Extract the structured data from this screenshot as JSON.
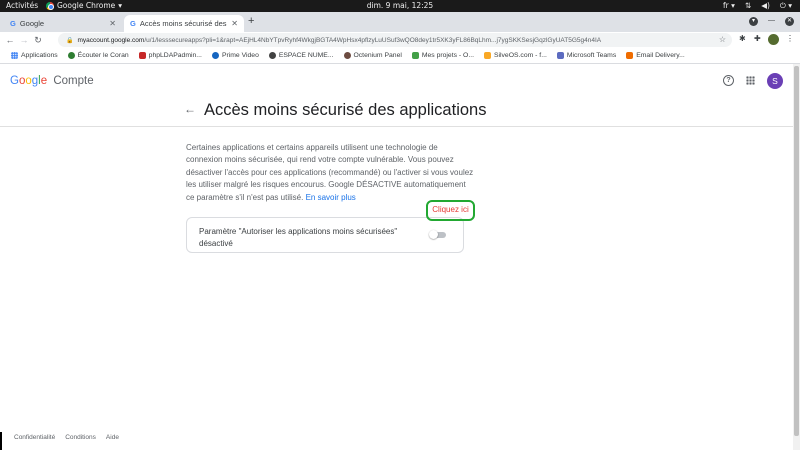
{
  "system_bar": {
    "activities": "Activités",
    "app_name": "Google Chrome",
    "clock": "dim. 9 mai, 12:25",
    "lang": "fr"
  },
  "tabs": [
    {
      "label": "Google",
      "active": false
    },
    {
      "label": "Accès moins sécurisé des",
      "active": true
    }
  ],
  "omnibox": {
    "host": "myaccount.google.com",
    "path": "/u/1/lesssecureapps?pli=1&rapt=AEjHL4NbYTpvRyhf4WkgjBGTA4WpHsx4pflzyLuUSuf3wQO8dey1tr5XK3yFL86BqLhm...j7ygSKKSesjGqzlGyUAT5G5g4n4IA"
  },
  "bookmarks": [
    {
      "label": "Applications",
      "color": "#4285f4"
    },
    {
      "label": "Écouter le Coran",
      "color": "#2e7d32"
    },
    {
      "label": "phpLDAPadmin...",
      "color": "#c62828"
    },
    {
      "label": "Prime Video",
      "color": "#1565c0"
    },
    {
      "label": "ESPACE NUME...",
      "color": "#424242"
    },
    {
      "label": "Octenium Panel",
      "color": "#6d4c41"
    },
    {
      "label": "Mes projets - O...",
      "color": "#43a047"
    },
    {
      "label": "SilveOS.com - f...",
      "color": "#f9a825"
    },
    {
      "label": "Microsoft Teams",
      "color": "#5c6bc0"
    },
    {
      "label": "Email Delivery...",
      "color": "#ef6c00"
    }
  ],
  "header": {
    "logo_letters": [
      "G",
      "o",
      "o",
      "g",
      "l",
      "e"
    ],
    "product": "Compte",
    "help_glyph": "?",
    "user_initial": "S"
  },
  "page": {
    "title": "Accès moins sécurisé des applications",
    "description": "Certaines applications et certains appareils utilisent une technologie de connexion moins sécurisée, qui rend votre compte vulnérable. Vous pouvez désactiver l'accès pour ces applications (recommandé) ou l'activer si vous voulez les utiliser malgré les risques encourus. Google DÉSACTIVE automatiquement ce paramètre s'il n'est pas utilisé.",
    "learn_more": "En savoir plus",
    "setting_label": "Paramètre \"Autoriser les applications moins sécurisées\" désactivé",
    "toggle_on": false,
    "annotation": "Cliquez ici"
  },
  "footer": [
    "Confidentialité",
    "Conditions",
    "Aide"
  ],
  "colors": {
    "annotation_border": "#22a832",
    "annotation_text": "#e53935",
    "link": "#1a73e8",
    "avatar": "#6a3fb5"
  }
}
